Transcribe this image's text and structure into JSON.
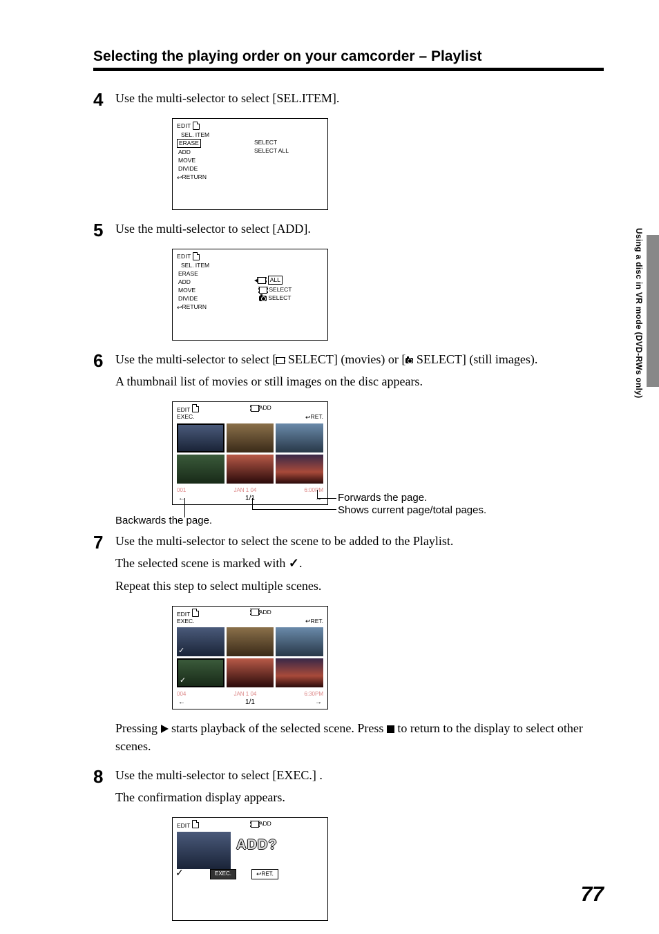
{
  "section_title": "Selecting the playing order on your camcorder – Playlist",
  "steps": {
    "s4": {
      "num": "4",
      "text": "Use the multi-selector to select [SEL.ITEM]."
    },
    "s5": {
      "num": "5",
      "text": "Use the multi-selector to select [ADD]."
    },
    "s6": {
      "num": "6",
      "pre": "Use the multi-selector to select  [",
      "mid": " SELECT] (movies) or [",
      "post": " SELECT] (still images).",
      "sub": "A thumbnail list of movies or still images on the disc appears."
    },
    "s7": {
      "num": "7",
      "text": "Use the multi-selector to select the scene to be added to the Playlist.",
      "sub1_pre": "The selected scene is marked with ",
      "sub1_post": ".",
      "sub2": "Repeat this step to select multiple scenes.",
      "sub3_pre": "Pressing ",
      "sub3_mid": " starts playback of the selected scene. Press ",
      "sub3_post": " to return to the display to select other scenes."
    },
    "s8": {
      "num": "8",
      "text": "Use the multi-selector to select  [EXEC.] .",
      "sub": "The confirmation display appears."
    }
  },
  "screen1": {
    "title": "EDIT",
    "header2": "SEL. ITEM",
    "items": [
      "ERASE",
      "ADD",
      "MOVE",
      "DIVIDE"
    ],
    "return": "RETURN",
    "r1": "SELECT",
    "r2": "SELECT ALL"
  },
  "screen2": {
    "title": "EDIT",
    "header2": "SEL. ITEM",
    "items": [
      "ERASE",
      "ADD",
      "MOVE",
      "DIVIDE"
    ],
    "return": "RETURN",
    "r1": "ALL",
    "r2": "SELECT",
    "r3": "SELECT"
  },
  "thumb1": {
    "title": "EDIT",
    "mode": "ADD",
    "ret": "RET.",
    "exec": "EXEC.",
    "footer_left": "001",
    "footer_mid": "JAN    1 04",
    "footer_right": "6:00PM",
    "pager": "1/1"
  },
  "thumb2": {
    "title": "EDIT",
    "mode": "ADD",
    "ret": "RET.",
    "exec": "EXEC.",
    "footer_left": "004",
    "footer_mid": "JAN    1 04",
    "footer_right": "6:30PM",
    "pager": "1/1"
  },
  "addscreen": {
    "title": "EDIT",
    "mode": "ADD",
    "q": "ADD?",
    "exec": "EXEC.",
    "ret": "RET."
  },
  "callouts": {
    "forwards": "Forwards the page.",
    "pages": "Shows current page/total pages.",
    "backwards": "Backwards the page."
  },
  "side_text": "Using a disc in VR mode (DVD-RWs only)",
  "page_number": "77",
  "glyphs": {
    "check": "✓",
    "return_arrow": "↩",
    "left_tri": "◀",
    "left_arr": "←",
    "right_arr": "→"
  }
}
